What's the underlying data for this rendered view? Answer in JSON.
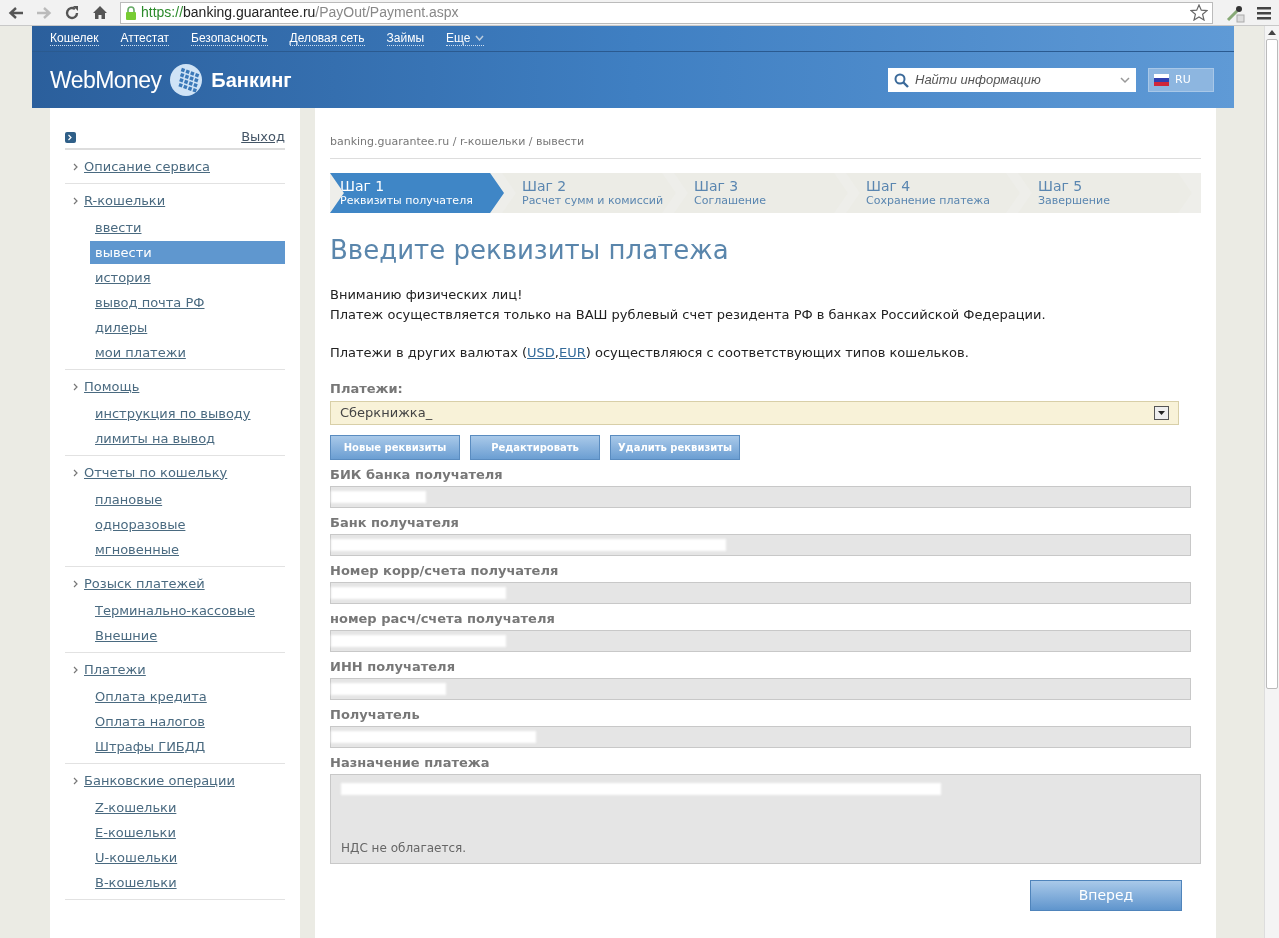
{
  "browser": {
    "url": {
      "scheme": "https://",
      "host": "banking.guarantee.ru",
      "path": "/PayOut/Payment.aspx"
    }
  },
  "header": {
    "nav": [
      "Кошелек",
      "Аттестат",
      "Безопасность",
      "Деловая сеть",
      "Займы",
      "Еще"
    ],
    "logo_left": "WebMoney",
    "logo_right": "Банкинг",
    "search": {
      "placeholder": "Найти информацию"
    },
    "language": "RU"
  },
  "sidebar": {
    "logout": "Выход",
    "groups": [
      {
        "label": "Описание сервиса"
      },
      {
        "label": "R-кошельки",
        "children": [
          {
            "label": "ввести",
            "selected": false
          },
          {
            "label": "вывести",
            "selected": true
          },
          {
            "label": "история",
            "selected": false
          },
          {
            "label": "вывод почта РФ",
            "selected": false
          },
          {
            "label": "дилеры",
            "selected": false
          },
          {
            "label": "мои платежи",
            "selected": false
          }
        ]
      },
      {
        "label": "Помощь",
        "children": [
          {
            "label": "инструкция по выводу",
            "selected": false
          },
          {
            "label": "лимиты на вывод",
            "selected": false
          }
        ]
      },
      {
        "label": "Отчеты по кошельку",
        "children": [
          {
            "label": "плановые",
            "selected": false
          },
          {
            "label": "одноразовые",
            "selected": false
          },
          {
            "label": "мгновенные",
            "selected": false
          }
        ]
      },
      {
        "label": "Розыск платежей",
        "children": [
          {
            "label": "Терминально-кассовые",
            "selected": false
          },
          {
            "label": "Внешние",
            "selected": false
          }
        ]
      },
      {
        "label": "Платежи",
        "children": [
          {
            "label": "Оплата кредита",
            "selected": false
          },
          {
            "label": "Оплата налогов",
            "selected": false
          },
          {
            "label": "Штрафы ГИБДД",
            "selected": false
          }
        ]
      },
      {
        "label": "Банковские операции",
        "children": [
          {
            "label": "Z-кошельки",
            "selected": false
          },
          {
            "label": "E-кошельки",
            "selected": false
          },
          {
            "label": "U-кошельки",
            "selected": false
          },
          {
            "label": "B-кошельки",
            "selected": false
          }
        ]
      }
    ]
  },
  "breadcrumb": "banking.guarantee.ru / r-кошельки / вывести",
  "steps": [
    {
      "title": "Шаг 1",
      "subtitle": "Реквизиты получателя",
      "selected": true
    },
    {
      "title": "Шаг 2",
      "subtitle": "Расчет сумм и комиссий",
      "selected": false
    },
    {
      "title": "Шаг 3",
      "subtitle": "Соглашение",
      "selected": false
    },
    {
      "title": "Шаг 4",
      "subtitle": "Сохранение платежа",
      "selected": false
    },
    {
      "title": "Шаг 5",
      "subtitle": "Завершение",
      "selected": false
    }
  ],
  "heading": "Введите реквизиты платежа",
  "notice": [
    "Вниманию физических лиц!",
    "Платеж осуществляется только на ВАШ рублевый счет резидента РФ в банках Российской Федерации."
  ],
  "currency_note": {
    "before": "Платежи в других валютах (",
    "links": [
      "USD",
      "EUR"
    ],
    "separator": ",",
    "after": ") осуществляюся с соответствующих типов кошельков."
  },
  "payments": {
    "label": "Платежи:",
    "value": "Сберкнижка_"
  },
  "actions": [
    "Новые реквизиты",
    "Редактировать",
    "Удалить реквизиты"
  ],
  "fields": [
    {
      "label": "БИК банка получателя"
    },
    {
      "label": "Банк получателя"
    },
    {
      "label": "Номер корр/счета получателя"
    },
    {
      "label": "номер расч/счета получателя"
    },
    {
      "label": "ИНН получателя"
    },
    {
      "label": "Получатель"
    }
  ],
  "purpose": {
    "label": "Назначение платежа",
    "value": "НДС не облагается."
  },
  "submit": "Вперед"
}
